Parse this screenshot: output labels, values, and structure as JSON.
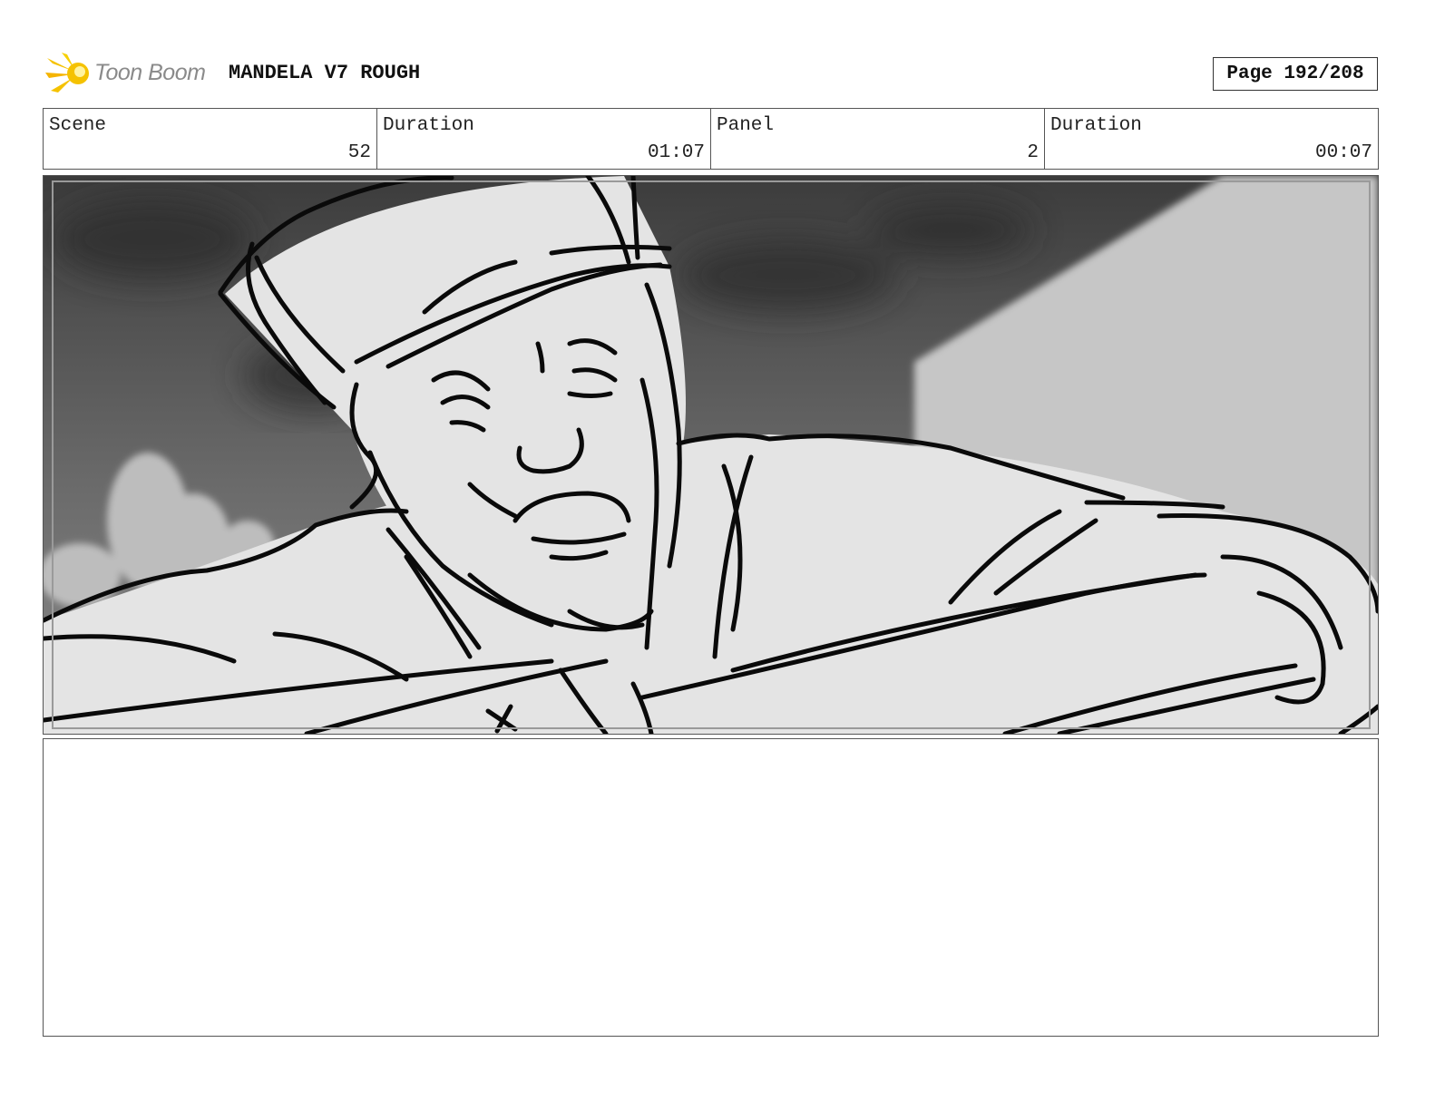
{
  "header": {
    "logo_text": "Toon Boom",
    "project_title": "MANDELA V7 ROUGH",
    "page_label": "Page 192/208"
  },
  "info": {
    "scene_label": "Scene",
    "scene_value": "52",
    "scene_duration_label": "Duration",
    "scene_duration_value": "01:07",
    "panel_label": "Panel",
    "panel_value": "2",
    "panel_duration_label": "Duration",
    "panel_duration_value": "00:07"
  },
  "colors": {
    "logo_flame": "#f5c200",
    "logo_text": "#8a8a8a"
  },
  "notes": {
    "text": ""
  }
}
